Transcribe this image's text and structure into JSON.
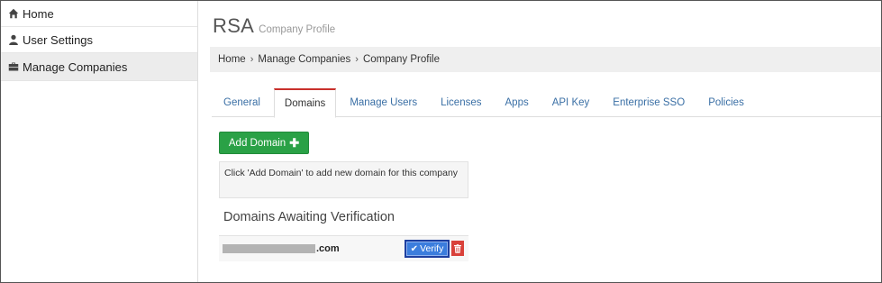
{
  "sidebar": {
    "items": [
      {
        "label": "Home",
        "icon": "home-icon"
      },
      {
        "label": "User Settings",
        "icon": "user-icon"
      },
      {
        "label": "Manage Companies",
        "icon": "briefcase-icon",
        "active": true
      }
    ]
  },
  "header": {
    "title": "RSA",
    "subtitle": "Company Profile"
  },
  "breadcrumb": {
    "items": [
      "Home",
      "Manage Companies",
      "Company Profile"
    ],
    "separator": "›"
  },
  "tabs": [
    {
      "label": "General"
    },
    {
      "label": "Domains",
      "active": true
    },
    {
      "label": "Manage Users"
    },
    {
      "label": "Licenses"
    },
    {
      "label": "Apps"
    },
    {
      "label": "API Key"
    },
    {
      "label": "Enterprise SSO"
    },
    {
      "label": "Policies"
    }
  ],
  "domains": {
    "add_button_label": "Add Domain",
    "add_button_icon": "plus-icon",
    "hint": "Click 'Add Domain' to add new domain for this company",
    "awaiting_title": "Domains Awaiting Verification",
    "pending": [
      {
        "domain_suffix": ".com",
        "verify_label": "Verify",
        "verify_icon": "check-icon",
        "delete_icon": "trash-icon"
      }
    ]
  },
  "colors": {
    "add_button": "#2aa146",
    "verify_button": "#3b7ddd",
    "delete_button": "#d9413a",
    "active_tab_border": "#c9302c",
    "tab_link": "#3a6fa5"
  }
}
